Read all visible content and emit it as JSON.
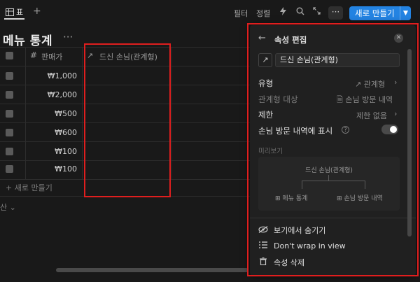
{
  "toolbar": {
    "view_tab_label": "표",
    "add_view": "+",
    "filter": "필터",
    "sort": "정렬",
    "more": "···",
    "new_button": "새로 만들기"
  },
  "page": {
    "title": "메뉴 통계",
    "title_more": "···"
  },
  "table": {
    "columns": {
      "price_hash": "#",
      "price": "판매가",
      "relation_arrow": "↗",
      "relation": "드신 손님(관계형)"
    },
    "rows": [
      {
        "price": "₩1,000"
      },
      {
        "price": "₩2,000"
      },
      {
        "price": "₩500"
      },
      {
        "price": "₩600"
      },
      {
        "price": "₩100"
      },
      {
        "price": "₩100"
      }
    ],
    "new_row": "+ 새로 만들기",
    "calculate": "산 ⌄"
  },
  "panel": {
    "title": "속성 편집",
    "property_name": "드신 손님(관계형)",
    "type_label": "유형",
    "type_value": "↗ 관계형",
    "related_label": "관계형 대상",
    "related_value": "🗎 손님 방문 내역",
    "limit_label": "제한",
    "limit_value": "제한 없음",
    "show_on_label": "손님 방문 내역에 표시",
    "help": "?",
    "show_on_enabled": false,
    "preview_label": "미리보기",
    "preview": {
      "top": "드신 손님(관계형)",
      "left": "⊞ 메뉴 통계",
      "right": "⊞ 손님 방문 내역"
    },
    "actions": {
      "hide": "보기에서 숨기기",
      "wrap": "Don't wrap in view",
      "delete": "속성 삭제"
    }
  },
  "colors": {
    "accent": "#2383e2",
    "highlight": "#e01e1e",
    "background": "#191919"
  }
}
